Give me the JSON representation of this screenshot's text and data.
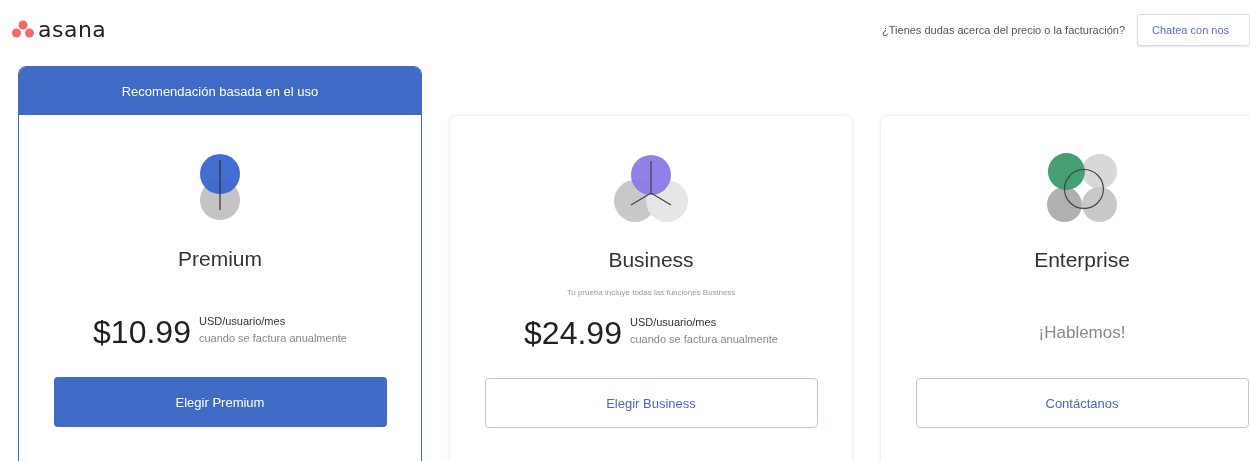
{
  "header": {
    "logo": "asana",
    "question": "¿Tienes dudas acerca del precio o la facturación?",
    "chat_button": "Chatea con nos"
  },
  "plans": [
    {
      "kind": "premium",
      "recommended": true,
      "banner": "Recomendación basada en el uso",
      "name": "Premium",
      "price": "$10.99",
      "unit": "USD/usuario/mes",
      "note": "cuando se factura anualmente",
      "button": "Elegir Premium"
    },
    {
      "kind": "business",
      "recommended": false,
      "name": "Business",
      "subtitle": "Tu prueba incluye todas las funciones Business",
      "price": "$24.99",
      "unit": "USD/usuario/mes",
      "note": "cuando se factura anualmente",
      "button": "Elegir Business"
    },
    {
      "kind": "enterprise",
      "recommended": false,
      "name": "Enterprise",
      "contact": "¡Hablemos!",
      "button": "Contáctanos"
    }
  ]
}
